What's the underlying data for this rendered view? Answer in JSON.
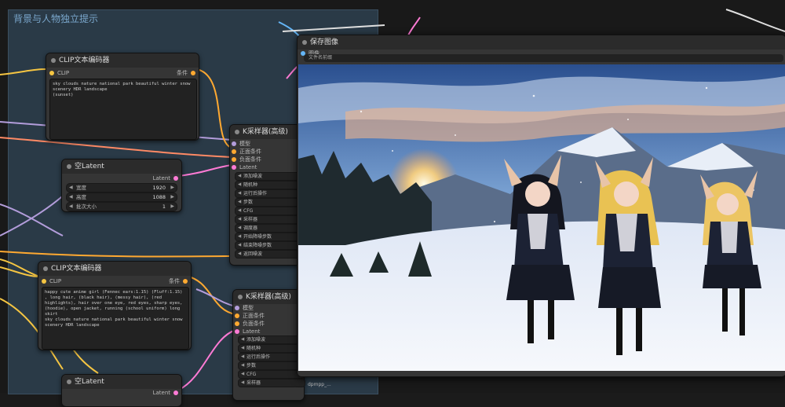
{
  "group": {
    "title": "背景与人物独立提示"
  },
  "clip_top": {
    "title": "CLIP文本编码器",
    "input": "CLIP",
    "output": "条件",
    "text": "sky clouds nature national park beautiful winter snow scenery HDR landscape\n(sunset)"
  },
  "latent_top": {
    "title": "空Latent",
    "output": "Latent",
    "fields": [
      {
        "label": "宽度",
        "value": "1920"
      },
      {
        "label": "高度",
        "value": "1088"
      },
      {
        "label": "批次大小",
        "value": "1"
      }
    ]
  },
  "clip_bottom": {
    "title": "CLIP文本编码器",
    "input": "CLIP",
    "output": "条件",
    "text": "happy cute anime girl (Fennec ears:1.15) (Fluff:1.15) , long hair, (black hair), (messy hair), (red highlights), hair over one eye, red eyes, sharp eyes, (hoodie), open jacket, running (school uniform) long skirt\nsky clouds nature national park beautiful winter snow scenery HDR landscape"
  },
  "latent_bottom": {
    "title": "空Latent",
    "output": "Latent"
  },
  "ksampler_top": {
    "title": "K采样器(高级)",
    "inputs": [
      "模型",
      "正面条件",
      "负面条件",
      "Latent"
    ],
    "widgets": [
      "添加噪波",
      "随机种",
      "运行后操作",
      "步数",
      "CFG",
      "采样器",
      "调度器",
      "开始降噪步数",
      "结束降噪步数",
      "返回噪波"
    ]
  },
  "ksampler_bottom": {
    "title": "K采样器(高级)",
    "inputs": [
      "模型",
      "正面条件",
      "负面条件",
      "Latent"
    ],
    "widgets": [
      "添加噪波",
      "随机种",
      "运行后操作",
      "步数",
      "CFG",
      "采样器"
    ],
    "extra_value": "dpmpp_..."
  },
  "save_image": {
    "title": "保存图像",
    "input": "图像",
    "filename_label": "文件名前缀"
  },
  "colors": {
    "clip": "#f5c542",
    "conditioning": "#ffa931",
    "latent": "#ff7bd5",
    "model": "#b39ddb",
    "image": "#64b5f6",
    "group_bg": "#2a3a47"
  }
}
